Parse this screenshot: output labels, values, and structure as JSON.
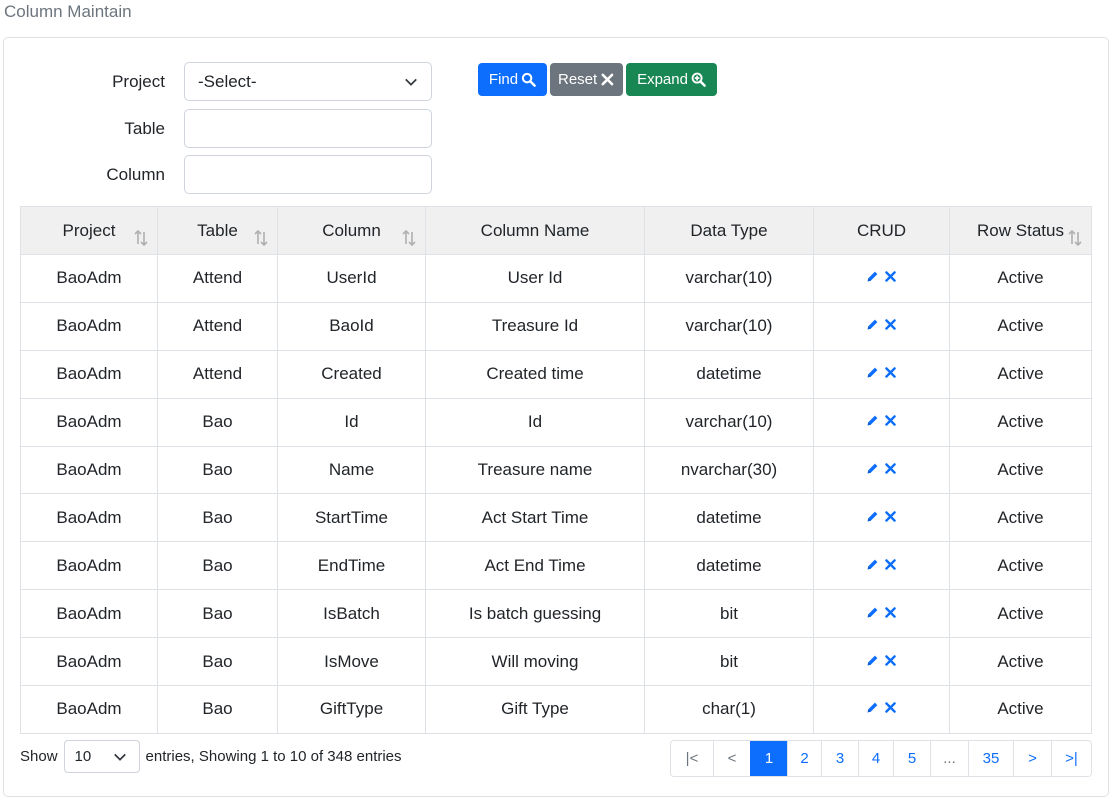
{
  "page": {
    "title": "Column Maintain"
  },
  "form": {
    "project_label": "Project",
    "project_value": "-Select-",
    "table_label": "Table",
    "table_value": "",
    "column_label": "Column",
    "column_value": ""
  },
  "buttons": {
    "find": "Find",
    "reset": "Reset",
    "expand": "Expand"
  },
  "table": {
    "headers": [
      "Project",
      "Table",
      "Column",
      "Column Name",
      "Data Type",
      "CRUD",
      "Row Status"
    ],
    "rows": [
      [
        "BaoAdm",
        "Attend",
        "UserId",
        "User Id",
        "varchar(10)",
        "Active"
      ],
      [
        "BaoAdm",
        "Attend",
        "BaoId",
        "Treasure Id",
        "varchar(10)",
        "Active"
      ],
      [
        "BaoAdm",
        "Attend",
        "Created",
        "Created time",
        "datetime",
        "Active"
      ],
      [
        "BaoAdm",
        "Bao",
        "Id",
        "Id",
        "varchar(10)",
        "Active"
      ],
      [
        "BaoAdm",
        "Bao",
        "Name",
        "Treasure name",
        "nvarchar(30)",
        "Active"
      ],
      [
        "BaoAdm",
        "Bao",
        "StartTime",
        "Act Start Time",
        "datetime",
        "Active"
      ],
      [
        "BaoAdm",
        "Bao",
        "EndTime",
        "Act End Time",
        "datetime",
        "Active"
      ],
      [
        "BaoAdm",
        "Bao",
        "IsBatch",
        "Is batch guessing",
        "bit",
        "Active"
      ],
      [
        "BaoAdm",
        "Bao",
        "IsMove",
        "Will moving",
        "bit",
        "Active"
      ],
      [
        "BaoAdm",
        "Bao",
        "GiftType",
        "Gift Type",
        "char(1)",
        "Active"
      ]
    ]
  },
  "footer": {
    "show_label": "Show",
    "page_length": "10",
    "info": "entries, Showing 1 to 10 of 348 entries"
  },
  "pagination": {
    "first": "|<",
    "prev": "<",
    "pages": [
      "1",
      "2",
      "3",
      "4",
      "5",
      "...",
      "35"
    ],
    "next": ">",
    "last": ">|",
    "current": "1"
  },
  "colors": {
    "primary": "#0d6efd",
    "secondary": "#6c757d",
    "success": "#198754"
  },
  "icons": {
    "edit": "pencil-icon",
    "delete": "close-icon",
    "sort": "sort-icon",
    "find": "search-icon",
    "expand": "zoom-in-icon"
  }
}
